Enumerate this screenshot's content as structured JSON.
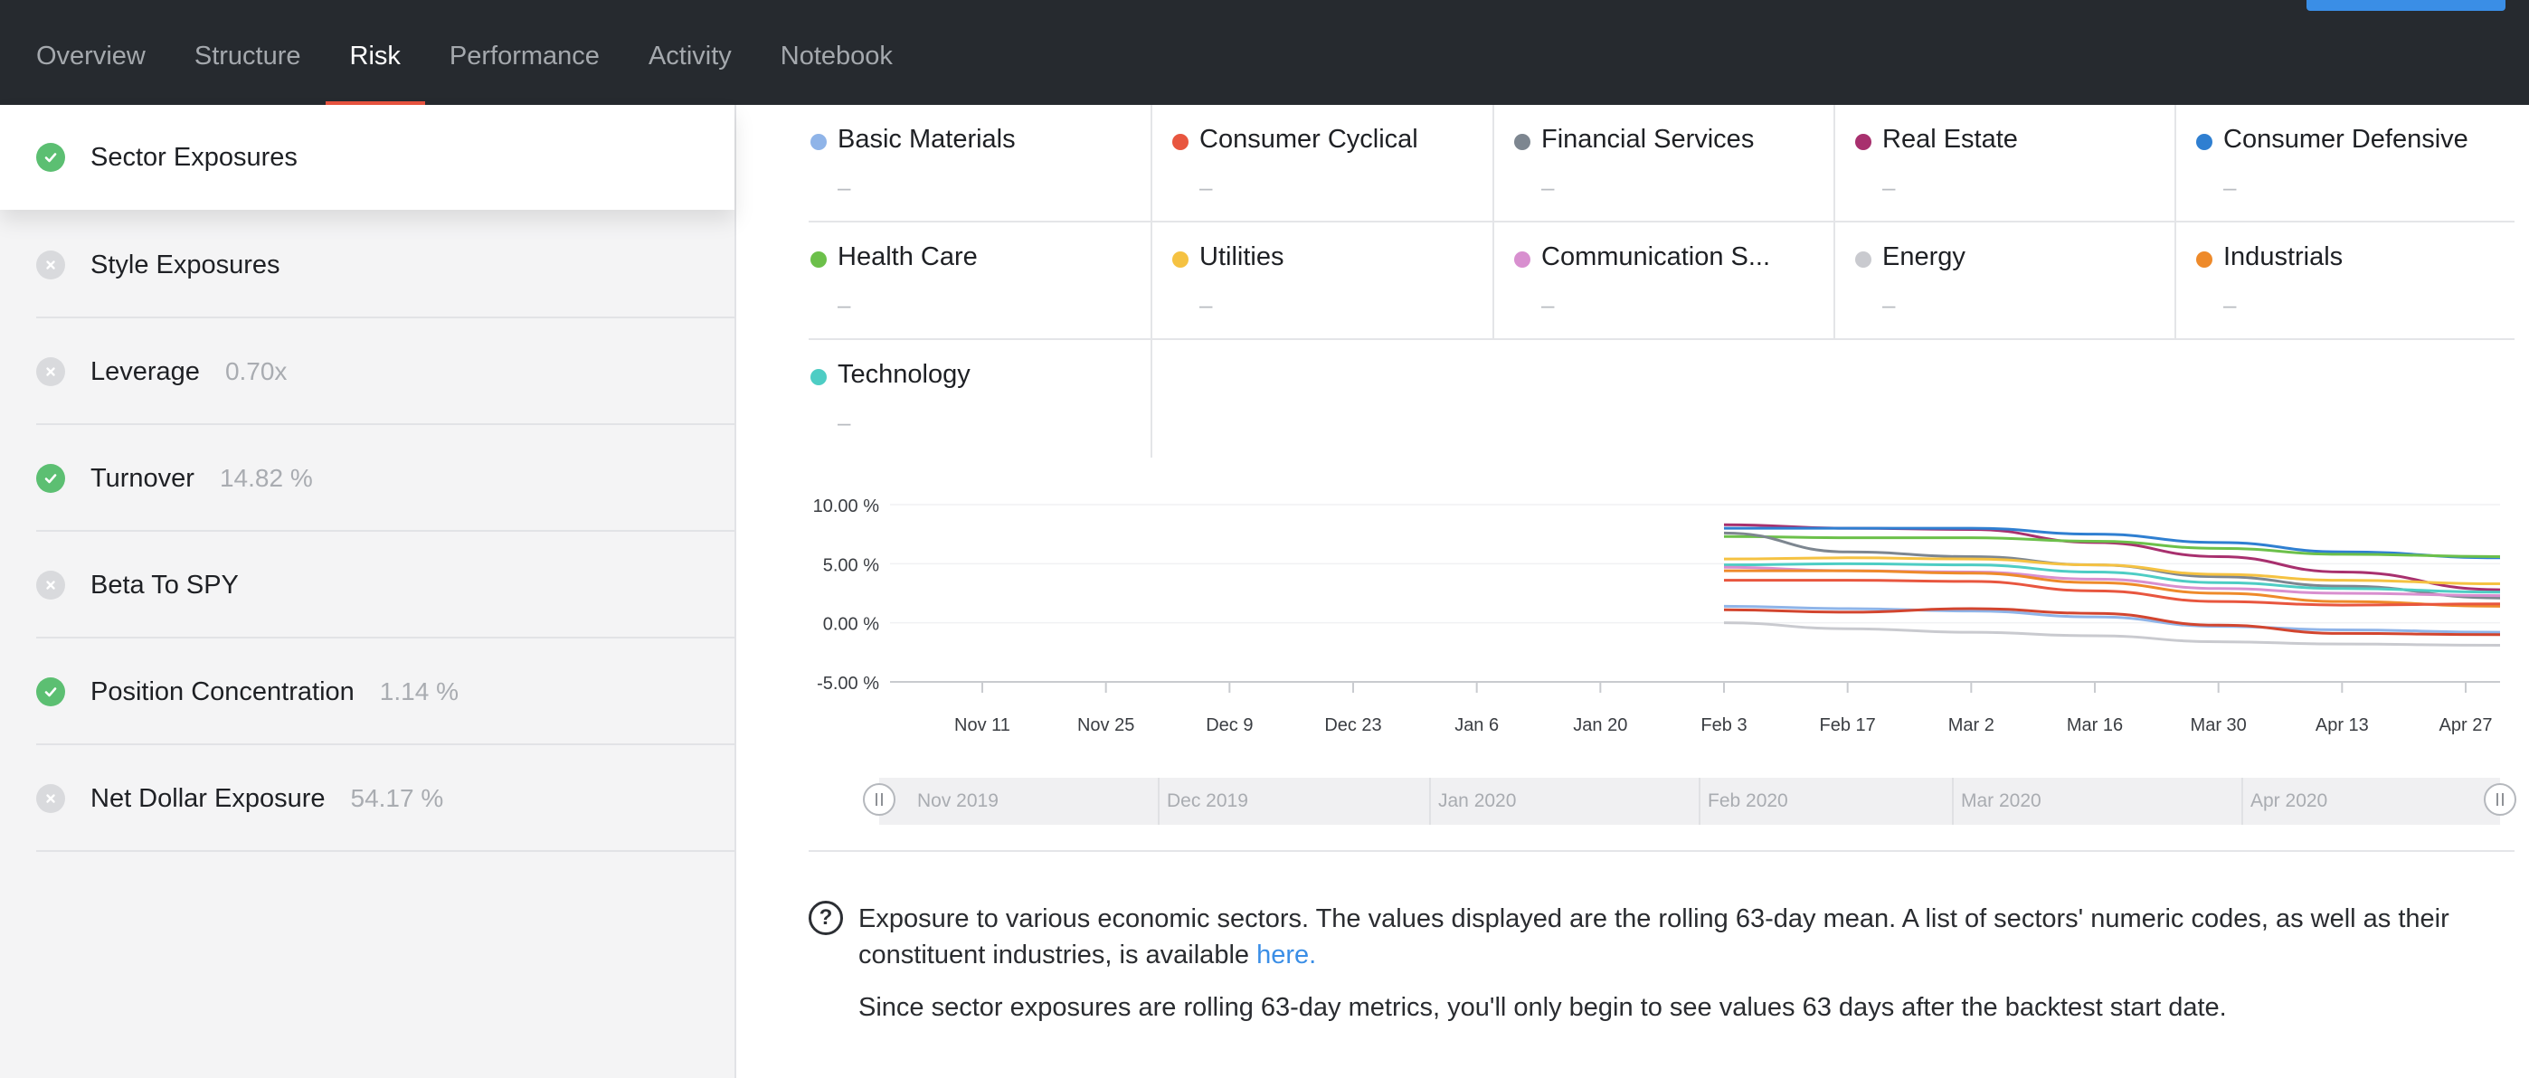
{
  "nav": {
    "tabs": [
      {
        "label": "Overview"
      },
      {
        "label": "Structure"
      },
      {
        "label": "Risk"
      },
      {
        "label": "Performance"
      },
      {
        "label": "Activity"
      },
      {
        "label": "Notebook"
      }
    ],
    "active_tab": "Risk",
    "accent_color": "#e8533f",
    "primary_color": "#3a8ee6"
  },
  "sidebar": {
    "items": [
      {
        "label": "Sector Exposures",
        "value": "",
        "status": "pass",
        "icon": "check-icon"
      },
      {
        "label": "Style Exposures",
        "value": "",
        "status": "fail",
        "icon": "x-icon"
      },
      {
        "label": "Leverage",
        "value": "0.70x",
        "status": "fail",
        "icon": "x-icon"
      },
      {
        "label": "Turnover",
        "value": "14.82 %",
        "status": "pass",
        "icon": "check-icon"
      },
      {
        "label": "Beta To SPY",
        "value": "",
        "status": "fail",
        "icon": "x-icon"
      },
      {
        "label": "Position Concentration",
        "value": "1.14 %",
        "status": "pass",
        "icon": "check-icon"
      },
      {
        "label": "Net Dollar Exposure",
        "value": "54.17 %",
        "status": "fail",
        "icon": "x-icon"
      }
    ]
  },
  "legend": {
    "items": [
      {
        "name": "Basic Materials",
        "value": "–",
        "color": "#8fb4e8"
      },
      {
        "name": "Consumer Cyclical",
        "value": "–",
        "color": "#e8563f"
      },
      {
        "name": "Financial Services",
        "value": "–",
        "color": "#7d8690"
      },
      {
        "name": "Real Estate",
        "value": "–",
        "color": "#a8306e"
      },
      {
        "name": "Consumer Defensive",
        "value": "–",
        "color": "#2f7fd1"
      },
      {
        "name": "Health Care",
        "value": "–",
        "color": "#6cc04a"
      },
      {
        "name": "Utilities",
        "value": "–",
        "color": "#f5c242"
      },
      {
        "name": "Communication S...",
        "value": "–",
        "color": "#d88fcf"
      },
      {
        "name": "Energy",
        "value": "–",
        "color": "#c9cacf"
      },
      {
        "name": "Industrials",
        "value": "–",
        "color": "#ee8a2a"
      },
      {
        "name": "Technology",
        "value": "–",
        "color": "#4ecdc4"
      }
    ]
  },
  "chart_data": {
    "type": "line",
    "y_ticks": [
      "10.00 %",
      "5.00 %",
      "0.00 %",
      "-5.00 %"
    ],
    "ylim": [
      -5,
      10
    ],
    "x_ticks": [
      "Nov 11",
      "Nov 25",
      "Dec 9",
      "Dec 23",
      "Jan 6",
      "Jan 20",
      "Feb 3",
      "Feb 17",
      "Mar 2",
      "Mar 16",
      "Mar 30",
      "Apr 13",
      "Apr 27"
    ],
    "x": [
      "Feb 3",
      "Feb 17",
      "Mar 2",
      "Mar 16",
      "Mar 30",
      "Apr 13",
      "May 1"
    ],
    "series": [
      {
        "name": "Real Estate",
        "color": "#a8306e",
        "values": [
          8.3,
          8.0,
          7.9,
          6.8,
          5.6,
          4.3,
          2.8
        ]
      },
      {
        "name": "Consumer Defensive",
        "color": "#2f7fd1",
        "values": [
          8.0,
          8.0,
          8.0,
          7.5,
          6.8,
          6.0,
          5.5
        ]
      },
      {
        "name": "Health Care",
        "color": "#6cc04a",
        "values": [
          7.3,
          7.2,
          7.2,
          6.9,
          6.3,
          5.8,
          5.6
        ]
      },
      {
        "name": "Financial Services",
        "color": "#7d8690",
        "values": [
          7.6,
          6.0,
          5.6,
          4.9,
          3.9,
          3.1,
          2.1
        ]
      },
      {
        "name": "Utilities",
        "color": "#f5c242",
        "values": [
          5.4,
          5.5,
          5.4,
          4.9,
          4.1,
          3.6,
          3.3
        ]
      },
      {
        "name": "Technology",
        "color": "#4ecdc4",
        "values": [
          4.9,
          5.0,
          4.9,
          4.3,
          3.4,
          2.9,
          2.6
        ]
      },
      {
        "name": "Communication S...",
        "color": "#d88fcf",
        "values": [
          4.7,
          4.4,
          4.3,
          3.7,
          2.9,
          2.5,
          2.3
        ]
      },
      {
        "name": "Industrials",
        "color": "#ee8a2a",
        "values": [
          4.4,
          4.4,
          4.2,
          3.4,
          2.5,
          1.8,
          1.4
        ]
      },
      {
        "name": "Consumer Cyclical",
        "color": "#e8563f",
        "values": [
          3.6,
          3.6,
          3.5,
          2.7,
          1.8,
          1.5,
          1.6
        ]
      },
      {
        "name": "Basic Materials",
        "color": "#8fb4e8",
        "values": [
          1.4,
          1.2,
          1.0,
          0.5,
          -0.3,
          -0.6,
          -0.8
        ]
      },
      {
        "name": "Energy",
        "color": "#c9cacf",
        "values": [
          0.0,
          -0.5,
          -0.8,
          -1.1,
          -1.6,
          -1.8,
          -1.9
        ]
      },
      {
        "name": "Consumer Cyclical",
        "color": "#d2452f",
        "values": [
          1.1,
          0.9,
          1.2,
          0.8,
          -0.2,
          -0.9,
          -1.0
        ]
      }
    ],
    "navigator_labels": [
      "Nov 2019",
      "Dec 2019",
      "Jan 2020",
      "Feb 2020",
      "Mar 2020",
      "Apr 2020"
    ],
    "grid": true
  },
  "description": {
    "text_before_link": "Exposure to various economic sectors. The values displayed are the rolling 63-day mean. A list of sectors' numeric codes, as well as their constituent industries, is available ",
    "link_text": "here.",
    "note": "Since sector exposures are rolling 63-day metrics, you'll only begin to see values 63 days after the backtest start date."
  }
}
